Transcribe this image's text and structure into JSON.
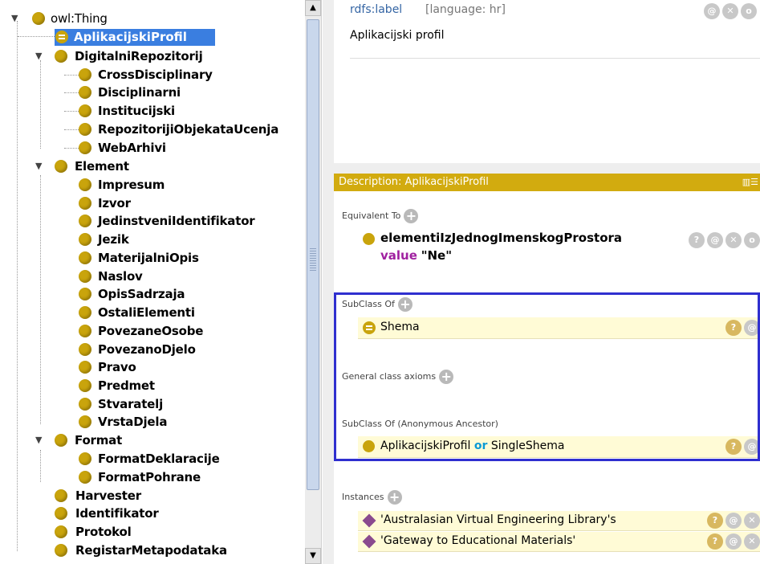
{
  "tree": {
    "root": "owl:Thing",
    "selected": "AplikacijskiProfil",
    "items": {
      "digitalni": "DigitalniRepozitorij",
      "cross": "CrossDisciplinary",
      "disciplinarni": "Disciplinarni",
      "institucijski": "Institucijski",
      "repozitoriji": "RepozitorijiObjekataUcenja",
      "webarhivi": "WebArhivi",
      "element": "Element",
      "impresum": "Impresum",
      "izvor": "Izvor",
      "jedinstveni": "JedinstveniIdentifikator",
      "jezik": "Jezik",
      "materijalni": "MaterijalniOpis",
      "naslov": "Naslov",
      "opis": "OpisSadrzaja",
      "ostali": "OstaliElementi",
      "povezaneosobe": "PovezaneOsobe",
      "povezanodjelo": "PovezanoDjelo",
      "pravo": "Pravo",
      "predmet": "Predmet",
      "stvaratelj": "Stvaratelj",
      "vrsta": "VrstaDjela",
      "format": "Format",
      "formatdek": "FormatDeklaracije",
      "formatpoh": "FormatPohrane",
      "harvester": "Harvester",
      "identifikator": "Identifikator",
      "protokol": "Protokol",
      "registar": "RegistarMetapodataka"
    }
  },
  "annotation": {
    "key": "rdfs:label",
    "lang": "[language: hr]",
    "value": "Aplikacijski profil"
  },
  "description": {
    "header": "Description: AplikacijskiProfil",
    "equivalent_to": "Equivalent To",
    "equiv_prop": "elementiIzJednogImenskogProstora",
    "equiv_kw": "value",
    "equiv_val": "\"Ne\"",
    "subclass_of": "SubClass Of",
    "subclass_val": "Shema",
    "general_axioms": "General class axioms",
    "subclass_anon": "SubClass Of (Anonymous Ancestor)",
    "anon_left": "AplikacijskiProfil",
    "anon_kw": "or",
    "anon_right": "SingleShema",
    "instances": "Instances",
    "instance_1": "'Australasian Virtual Engineering Library's",
    "instance_2": "'Gateway to Educational Materials'"
  }
}
